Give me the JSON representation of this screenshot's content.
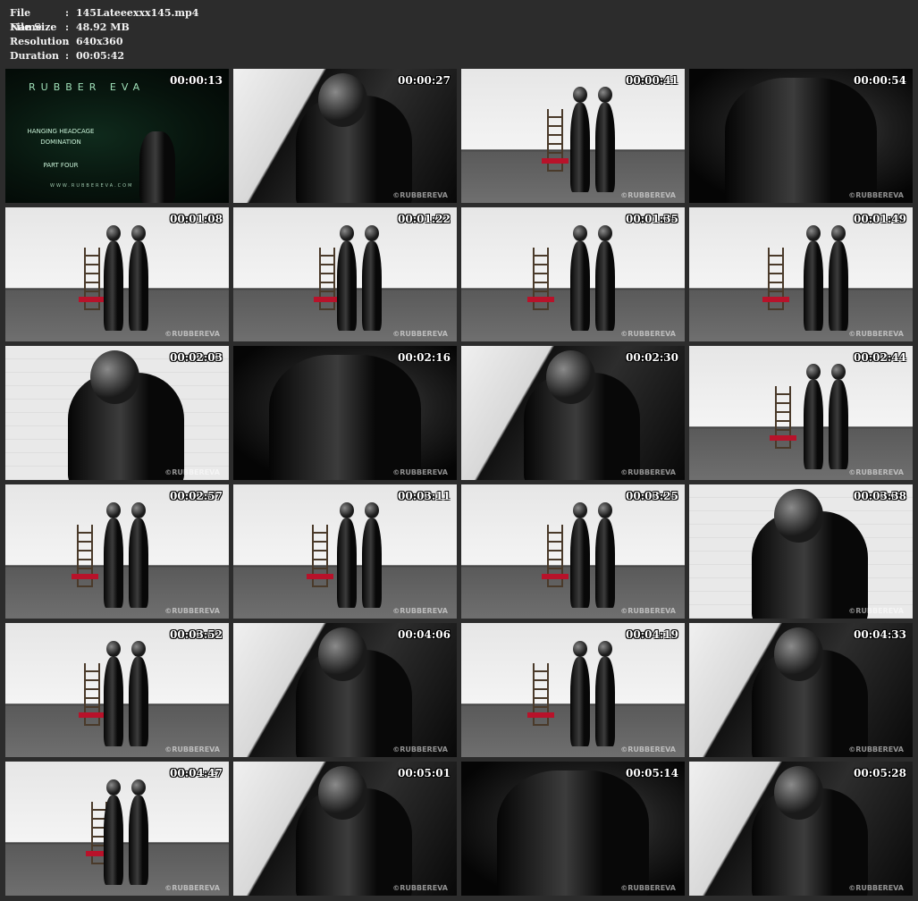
{
  "file_info": {
    "rows": [
      {
        "label": "File Name",
        "sep": ":",
        "value": "145Lateeexxx145.mp4"
      },
      {
        "label": "File Size",
        "sep": ":",
        "value": "48.92 MB"
      },
      {
        "label": "Resolution",
        "sep": ":",
        "value": "640x360"
      },
      {
        "label": "Duration",
        "sep": ":",
        "value": "00:05:42"
      }
    ]
  },
  "title_card": {
    "brand": "RUBBER EVA",
    "subtitle_line1": "HANGING HEADCAGE",
    "subtitle_line2": "DOMINATION",
    "part": "PART FOUR",
    "url": "WWW.RUBBEREVA.COM"
  },
  "watermark": "©RUBBEREVA",
  "thumbnails": [
    {
      "time": "00:00:13",
      "scene": "title"
    },
    {
      "time": "00:00:27",
      "scene": "close"
    },
    {
      "time": "00:00:41",
      "scene": "studio"
    },
    {
      "time": "00:00:54",
      "scene": "dark"
    },
    {
      "time": "00:01:08",
      "scene": "studio"
    },
    {
      "time": "00:01:22",
      "scene": "studio"
    },
    {
      "time": "00:01:35",
      "scene": "studio"
    },
    {
      "time": "00:01:49",
      "scene": "studio"
    },
    {
      "time": "00:02:03",
      "scene": "wall"
    },
    {
      "time": "00:02:16",
      "scene": "dark"
    },
    {
      "time": "00:02:30",
      "scene": "close"
    },
    {
      "time": "00:02:44",
      "scene": "studio"
    },
    {
      "time": "00:02:57",
      "scene": "studio"
    },
    {
      "time": "00:03:11",
      "scene": "studio"
    },
    {
      "time": "00:03:25",
      "scene": "studio"
    },
    {
      "time": "00:03:38",
      "scene": "wall"
    },
    {
      "time": "00:03:52",
      "scene": "studio"
    },
    {
      "time": "00:04:06",
      "scene": "close"
    },
    {
      "time": "00:04:19",
      "scene": "studio"
    },
    {
      "time": "00:04:33",
      "scene": "close"
    },
    {
      "time": "00:04:47",
      "scene": "studio"
    },
    {
      "time": "00:05:01",
      "scene": "close"
    },
    {
      "time": "00:05:14",
      "scene": "dark"
    },
    {
      "time": "00:05:28",
      "scene": "close"
    }
  ]
}
